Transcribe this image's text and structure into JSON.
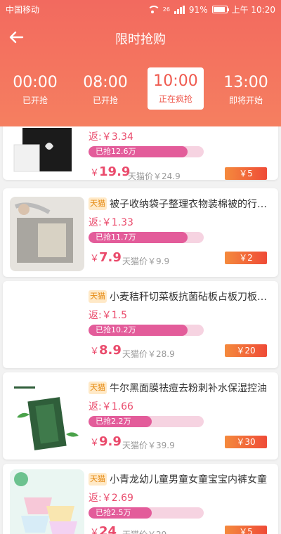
{
  "status_bar": {
    "carrier": "中国移动",
    "network": "26",
    "battery": "91%",
    "battery_level": 0.91,
    "time": "上午 10:20"
  },
  "nav": {
    "title": "限时抢购"
  },
  "tabs": [
    {
      "time": "00:00",
      "status": "已开抢"
    },
    {
      "time": "08:00",
      "status": "已开抢"
    },
    {
      "time": "10:00",
      "status": "正在疯抢"
    },
    {
      "time": "13:00",
      "status": "即将开始"
    }
  ],
  "products": [
    {
      "badge": "",
      "title": "",
      "rebate": "返:￥3.34",
      "sold": "已抢12.6万",
      "sold_level": 0.86,
      "currency": "￥",
      "price": "19.9",
      "tmall_price": "天猫价￥24.9",
      "coupon": "￥5"
    },
    {
      "badge": "天猫",
      "title": "被子收纳袋子整理衣物装棉被的行李收纳",
      "rebate": "返:￥1.33",
      "sold": "已抢11.7万",
      "sold_level": 0.86,
      "currency": "￥",
      "price": "7.9",
      "tmall_price": "天猫价￥9.9",
      "coupon": "￥2"
    },
    {
      "badge": "天猫",
      "title": "小麦秸秆切菜板抗菌砧板占板刀板家用",
      "rebate": "返:￥1.5",
      "sold": "已抢10.2万",
      "sold_level": 0.86,
      "currency": "￥",
      "price": "8.9",
      "tmall_price": "天猫价￥28.9",
      "coupon": "￥20"
    },
    {
      "badge": "天猫",
      "title": "牛尔黑面膜祛痘去粉刺补水保湿控油",
      "rebate": "返:￥1.66",
      "sold": "已抢2.2万",
      "sold_level": 0.55,
      "currency": "￥",
      "price": "9.9",
      "tmall_price": "天猫价￥39.9",
      "coupon": "￥30"
    },
    {
      "badge": "天猫",
      "title": "小青龙幼儿童男童女童宝宝内裤女童",
      "rebate": "返:￥2.69",
      "sold": "已抢2.5万",
      "sold_level": 0.55,
      "currency": "￥",
      "price": "24",
      "tmall_price": "天猫价￥29",
      "coupon": "￥5"
    }
  ],
  "colors": {
    "header_top": "#f26a5f",
    "accent": "#ea4b6c",
    "badge_bg": "#ffe9c7",
    "coupon": "#ef4b37"
  }
}
